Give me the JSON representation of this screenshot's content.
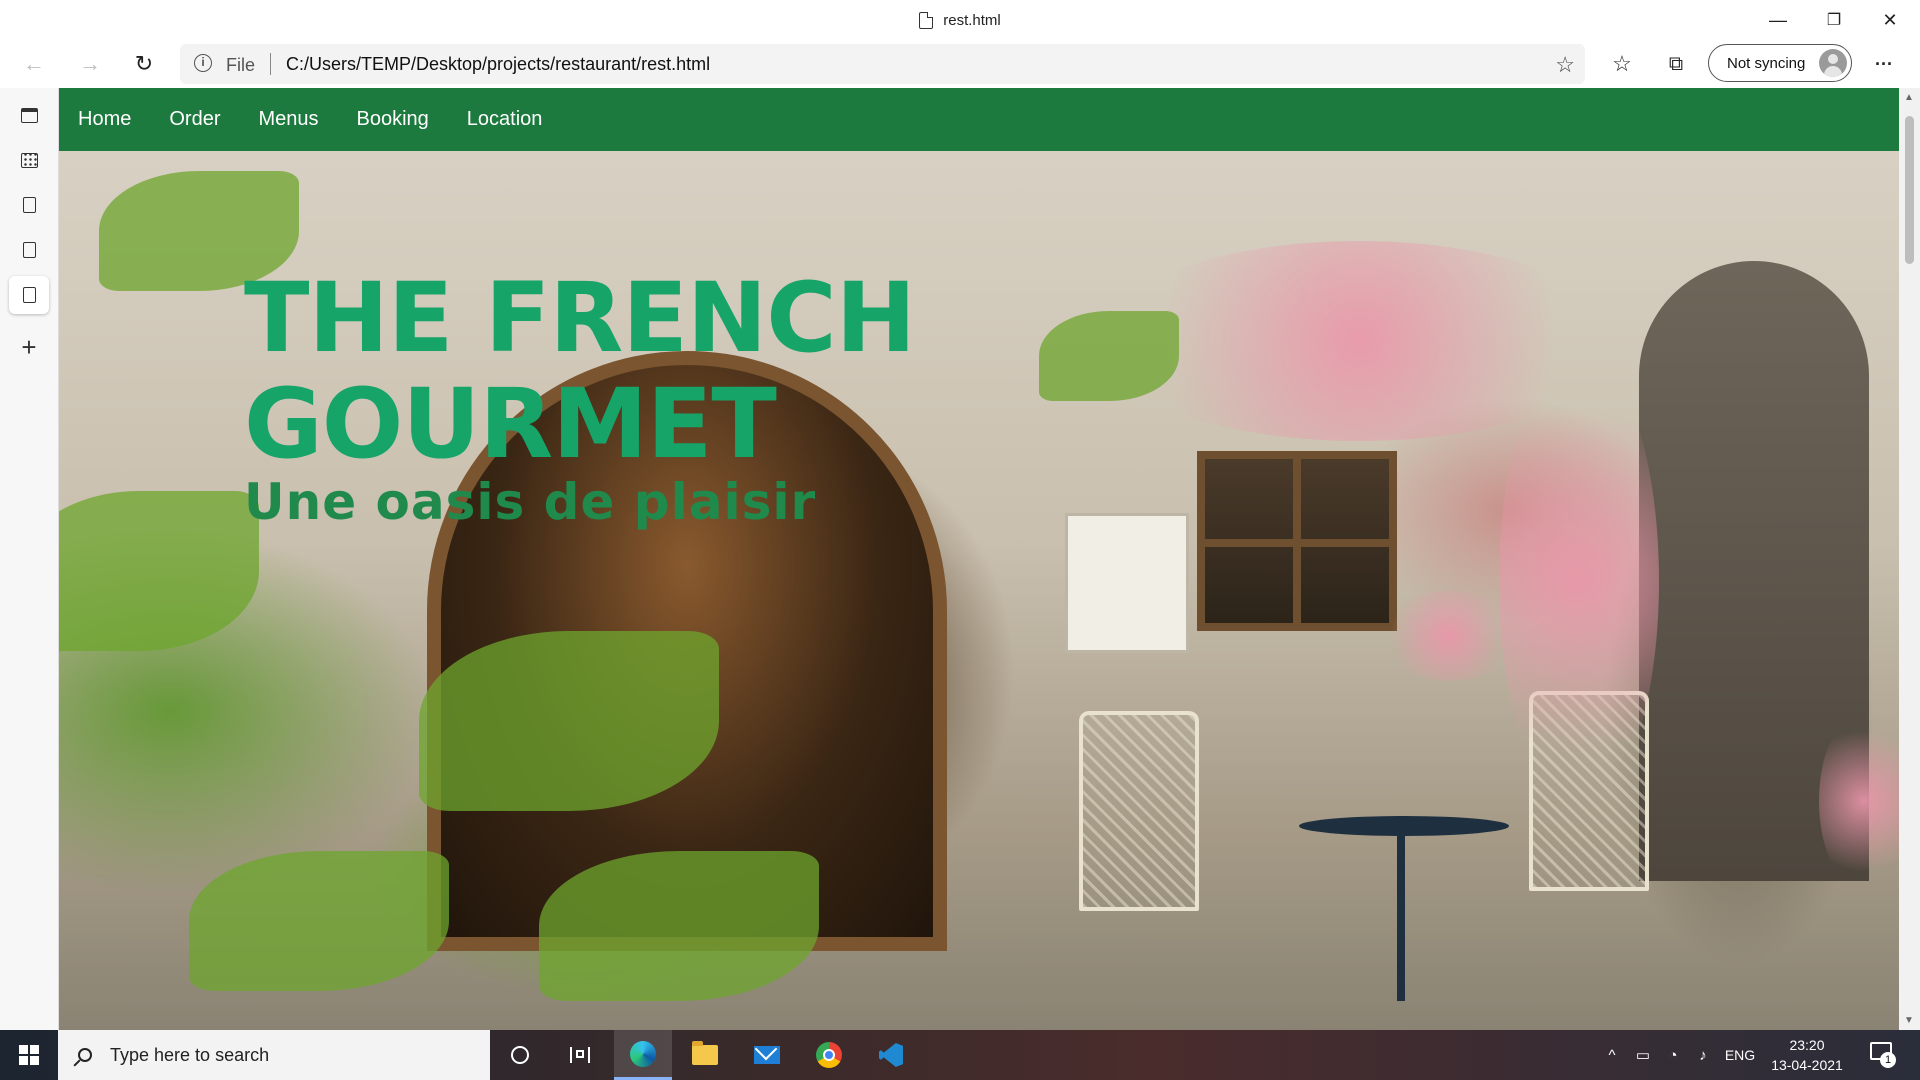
{
  "window": {
    "title": "rest.html",
    "minimize_glyph": "—",
    "restore_glyph": "❐",
    "close_glyph": "✕"
  },
  "toolbar": {
    "back_glyph": "←",
    "forward_glyph": "→",
    "refresh_glyph": "↻",
    "info_glyph": "i",
    "scheme_label": "File",
    "url": "C:/Users/TEMP/Desktop/projects/restaurant/rest.html",
    "add_favorite_glyph": "☆",
    "favorites_glyph": "☆",
    "collections_glyph": "⧉",
    "sync_label": "Not syncing",
    "more_glyph": "···"
  },
  "vertical_tabs": {
    "new_tab_glyph": "+"
  },
  "site": {
    "nav": [
      "Home",
      "Order",
      "Menus",
      "Booking",
      "Location"
    ],
    "hero_title": "THE FRENCH GOURMET",
    "hero_subtitle": "Une oasis de plaisir"
  },
  "scrollbar": {
    "up_glyph": "▲",
    "down_glyph": "▼"
  },
  "taskbar": {
    "search_placeholder": "Type here to search",
    "tray_chevron": "^",
    "language": "ENG",
    "time": "23:20",
    "date": "13-04-2021",
    "notification_count": "1"
  },
  "colors": {
    "navbar": "#1c7a3e",
    "hero_title": "#16a468",
    "hero_subtitle": "#1f8a4c"
  }
}
